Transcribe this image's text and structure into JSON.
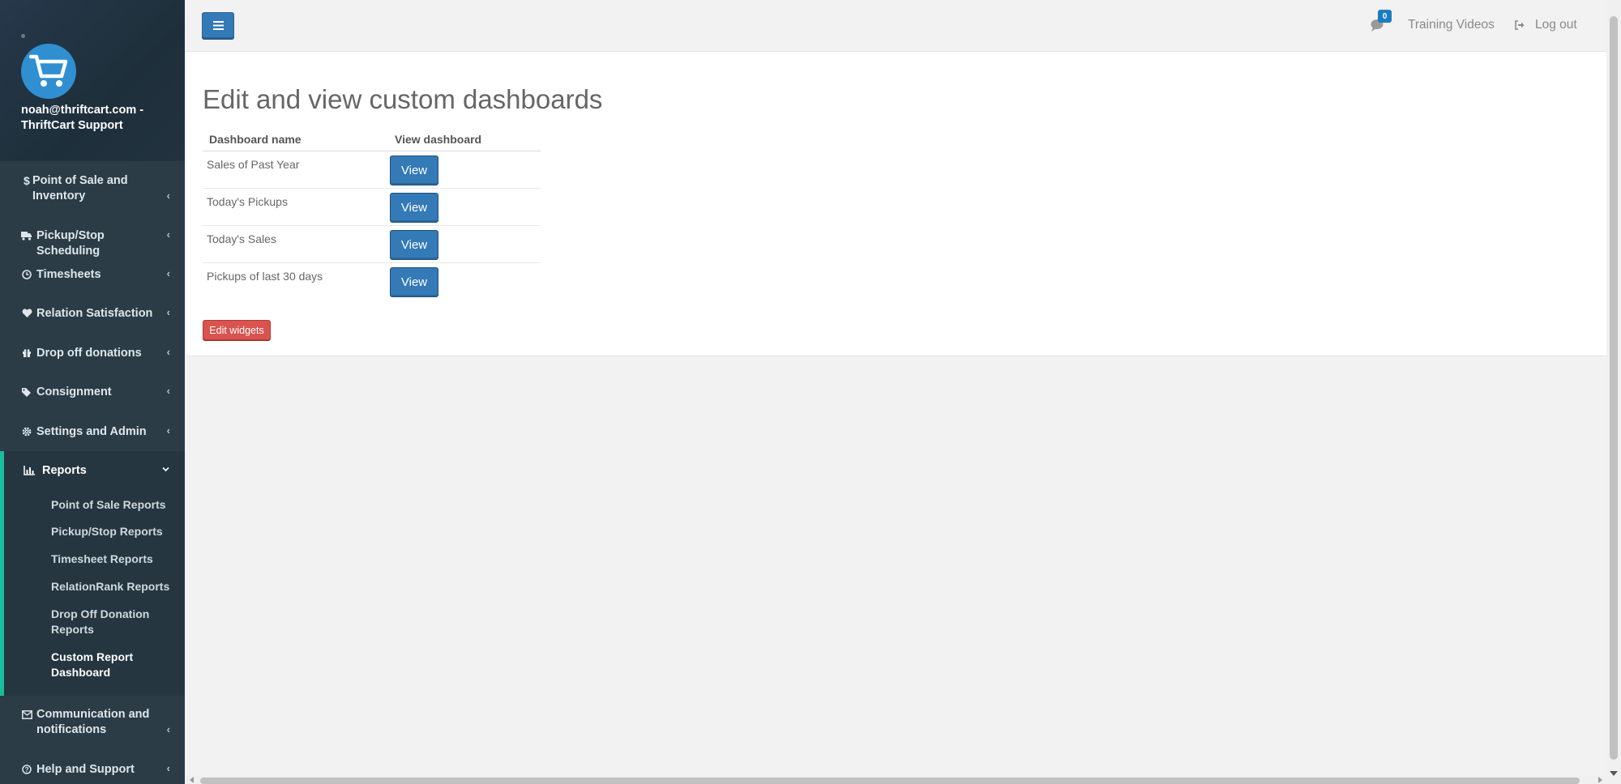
{
  "user": {
    "name": "noah@thriftcart.com - ThriftCart Support"
  },
  "sidebar": {
    "items": [
      {
        "label": "Point of Sale and Inventory",
        "icon": "dollar-icon"
      },
      {
        "label": "Pickup/Stop Scheduling",
        "icon": "truck-icon"
      },
      {
        "label": "Timesheets",
        "icon": "clock-icon"
      },
      {
        "label": "Relation Satisfaction",
        "icon": "heart-icon"
      },
      {
        "label": "Drop off donations",
        "icon": "gift-icon"
      },
      {
        "label": "Consignment",
        "icon": "tags-icon"
      },
      {
        "label": "Settings and Admin",
        "icon": "gear-icon"
      },
      {
        "label": "Reports",
        "icon": "bar-chart-icon"
      },
      {
        "label": "Communication and notifications",
        "icon": "envelope-icon"
      },
      {
        "label": "Help and Support",
        "icon": "question-icon"
      }
    ],
    "reports_sub": [
      {
        "label": "Point of Sale Reports"
      },
      {
        "label": "Pickup/Stop Reports"
      },
      {
        "label": "Timesheet Reports"
      },
      {
        "label": "RelationRank Reports"
      },
      {
        "label": "Drop Off Donation Reports"
      },
      {
        "label": "Custom Report Dashboard"
      }
    ]
  },
  "topbar": {
    "chat_count": "0",
    "training_videos": "Training Videos",
    "logout": "Log out"
  },
  "main": {
    "title": "Edit and view custom dashboards",
    "table": {
      "headers": [
        "Dashboard name",
        "View dashboard"
      ],
      "rows": [
        {
          "name": "Sales of Past Year",
          "button": "View"
        },
        {
          "name": "Today's Pickups",
          "button": "View"
        },
        {
          "name": "Today's Sales",
          "button": "View"
        },
        {
          "name": "Pickups of last 30 days",
          "button": "View"
        }
      ]
    },
    "edit_widgets": "Edit widgets"
  },
  "colors": {
    "sidebar_bg": "#2b3c47",
    "accent": "#1abc9c",
    "primary_button": "#337ab7",
    "danger_button": "#d9534f"
  }
}
